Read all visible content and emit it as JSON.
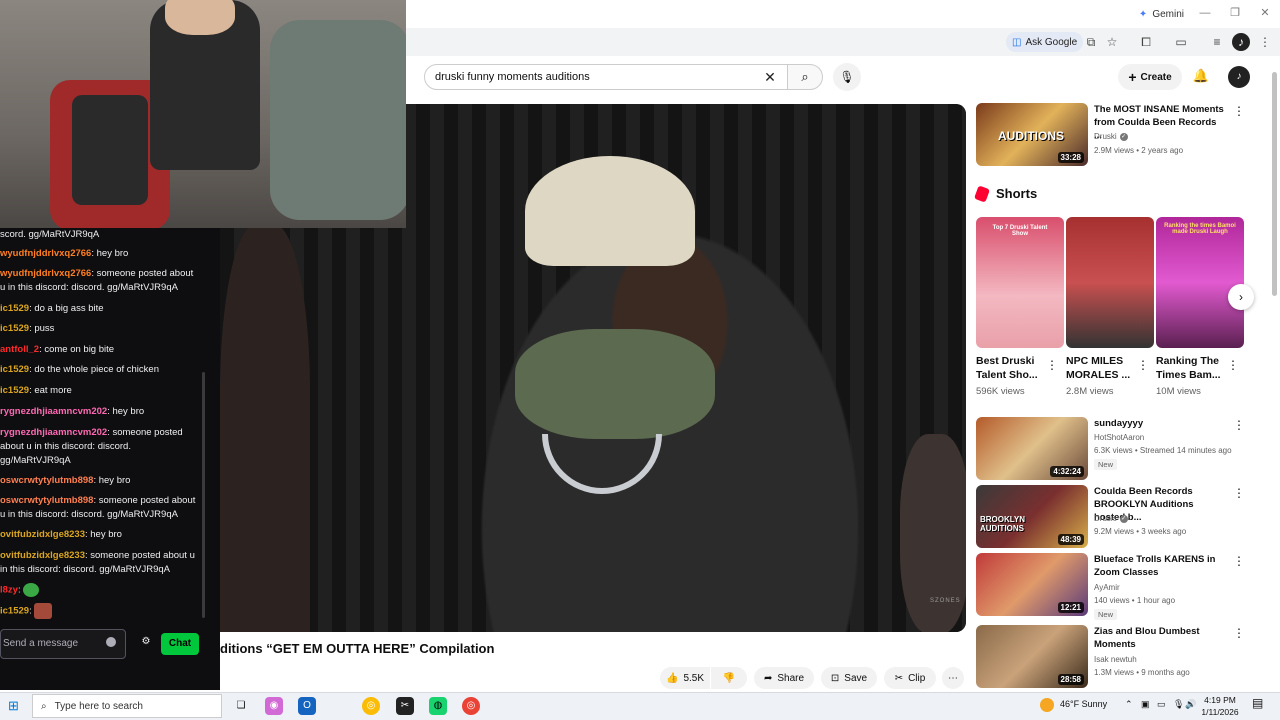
{
  "browser": {
    "gemini_label": "Gemini",
    "ask_google_label": "Ask Google"
  },
  "youtube": {
    "search_query": "druski funny moments auditions",
    "create_label": "Create",
    "video": {
      "title": "ditions “GET EM OUTTA HERE” Compilation",
      "watermark": "SZONES",
      "likes": "5.5K",
      "share_label": "Share",
      "save_label": "Save",
      "clip_label": "Clip"
    },
    "shorts_header": "Shorts",
    "sidebar": [
      {
        "title": "The MOST INSANE Moments from Coulda Been Records ...",
        "channel": "Druski",
        "verified": true,
        "meta": "2.9M views • 2 years ago",
        "duration": "33:28",
        "badge": ""
      },
      {
        "title": "sundayyyy",
        "channel": "HotShotAaron",
        "verified": false,
        "meta": "6.3K views • Streamed 14 minutes ago",
        "duration": "4:32:24",
        "badge": "New"
      },
      {
        "title": "Coulda Been Records BROOKLYN Auditions hosted b...",
        "channel": "Druski",
        "verified": true,
        "meta": "9.2M views • 3 weeks ago",
        "duration": "48:39",
        "badge": ""
      },
      {
        "title": "Blueface Trolls KARENS in Zoom Classes",
        "channel": "AyAmir",
        "verified": false,
        "meta": "140 views • 1 hour ago",
        "duration": "12:21",
        "badge": "New"
      },
      {
        "title": "Zias and Blou Dumbest Moments",
        "channel": "Isak newtuh",
        "verified": false,
        "meta": "1.3M views • 9 months ago",
        "duration": "28:58",
        "badge": ""
      }
    ],
    "shorts": [
      {
        "title": "Best Druski Talent Sho...",
        "views": "596K views"
      },
      {
        "title": "NPC MILES MORALES ...",
        "views": "2.8M views"
      },
      {
        "title": "Ranking The Times Bam...",
        "views": "10M views"
      }
    ],
    "thumb_text": {
      "t1": "AUDITIONS",
      "t3": "BROOKLYN AUDITIONS",
      "s1": "Top 7 Druski Talent Show",
      "s3": "Ranking the times Bamoi made Druski Laugh"
    }
  },
  "chat": {
    "messages": [
      {
        "user": "",
        "text": "scord. gg/MaRtVJR9qA",
        "color": "#efeff1"
      },
      {
        "user": "wyudfnjddrlvxq2766",
        "text": ": hey bro",
        "color": "#ff7f24"
      },
      {
        "user": "wyudfnjddrlvxq2766",
        "text": ": someone posted about u in this discord: discord. gg/MaRtVJR9qA",
        "color": "#ff7f24"
      },
      {
        "user": "ic1529",
        "text": ": do a big ass bite",
        "color": "#daa520"
      },
      {
        "user": "ic1529",
        "text": ": puss",
        "color": "#daa520"
      },
      {
        "user": "antfoll_2",
        "text": ": come on big bite",
        "color": "#ff2a2a"
      },
      {
        "user": "ic1529",
        "text": ": do the whole piece of chicken",
        "color": "#daa520"
      },
      {
        "user": "ic1529",
        "text": ": eat more",
        "color": "#daa520"
      },
      {
        "user": "rygnezdhjiaamncvm202",
        "text": ": hey bro",
        "color": "#ff69b4"
      },
      {
        "user": "rygnezdhjiaamncvm202",
        "text": ": someone posted about u in this discord: discord. gg/MaRtVJR9qA",
        "color": "#ff69b4"
      },
      {
        "user": "oswcrwtytylutmb898",
        "text": ": hey bro",
        "color": "#ff7f50"
      },
      {
        "user": "oswcrwtytylutmb898",
        "text": ": someone posted about u in this discord: discord. gg/MaRtVJR9qA",
        "color": "#ff7f50"
      },
      {
        "user": "ovitfubzidxlge8233",
        "text": ": hey bro",
        "color": "#daa520"
      },
      {
        "user": "ovitfubzidxlge8233",
        "text": ": someone posted about u in this discord: discord. gg/MaRtVJR9qA",
        "color": "#daa520"
      },
      {
        "user": "l8zy",
        "text": ":",
        "color": "#ff2a2a"
      },
      {
        "user": "ic1529",
        "text": ":",
        "color": "#daa520"
      }
    ],
    "input_placeholder": "Send a message",
    "chat_button": "Chat"
  },
  "taskbar": {
    "search_placeholder": "Type here to search",
    "weather": "46°F  Sunny",
    "time": "4:19 PM",
    "date": "1/11/2026"
  },
  "colors": {
    "chat_bg": "#0e0e10",
    "chat_button": "#00c73b",
    "youtube_red": "#ff0033"
  }
}
